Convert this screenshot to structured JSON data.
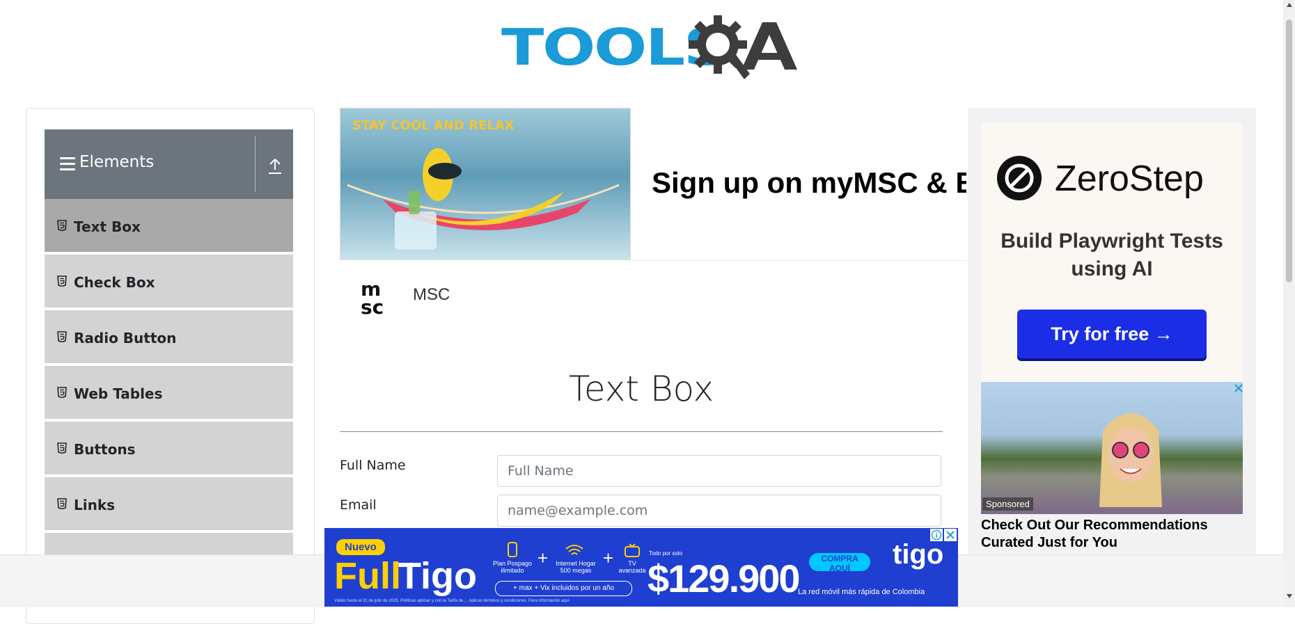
{
  "header": {
    "logo_text": "TOOLS",
    "logo_suffix": "A"
  },
  "sidebar": {
    "group_title": "Elements",
    "items": [
      {
        "label": "Text Box",
        "active": true
      },
      {
        "label": "Check Box",
        "active": false
      },
      {
        "label": "Radio Button",
        "active": false
      },
      {
        "label": "Web Tables",
        "active": false
      },
      {
        "label": "Buttons",
        "active": false
      },
      {
        "label": "Links",
        "active": false
      }
    ]
  },
  "top_ad": {
    "tagline": "STAY COOL AND RELAX",
    "headline": "Sign up on myMSC & B",
    "brand_name": "MSC"
  },
  "main": {
    "title": "Text Box",
    "full_name": {
      "label": "Full Name",
      "placeholder": "Full Name",
      "value": ""
    },
    "email": {
      "label": "Email",
      "placeholder": "name@example.com",
      "value": ""
    }
  },
  "right_ad": {
    "brand": "ZeroStep",
    "tagline": "Build Playwright Tests using AI",
    "cta": "Try for free →",
    "sponsored_label": "Sponsored",
    "sponsored_title": "Check Out Our Recommendations Curated Just for You"
  },
  "bottom_ad": {
    "badge": "Nuevo",
    "title_full": "Full",
    "title_tigo": "Tigo",
    "plus_sign": "+",
    "feature_1": "Plan Pospago ilimitado",
    "feature_2": "Internet Hogar 500 megas",
    "feature_3": "TV avanzada",
    "pill": "+ max + Vix incluidos por un año",
    "price_label": "Todo por solo",
    "price": "$129.900",
    "cta": "COMPRA AQUÍ",
    "brand": "tigo",
    "slogan": "La red móvil más rápida de Colombia",
    "legal": "Válido hasta el 31 de julio de 2025. Políticas aplican y con la Tarifa de ... Aplican términos y condiciones. Para información aquí"
  },
  "colors": {
    "logo_blue": "#1b9bd7",
    "logo_gray": "#3d3d3d",
    "sidebar_header": "#6c757d",
    "menu_item": "#d3d3d3",
    "menu_item_active": "#a9a9a9",
    "zerostep_cta": "#1b2ee6",
    "tigo_blue": "#1f3fd1",
    "tigo_yellow": "#ffd000"
  },
  "icons": {
    "sidebar_group": "hamburger-icon",
    "collapse": "upload-arrow-icon",
    "menu_item": "html5-file-icon",
    "ad_close": "close-icon",
    "ad_info": "info-icon"
  }
}
